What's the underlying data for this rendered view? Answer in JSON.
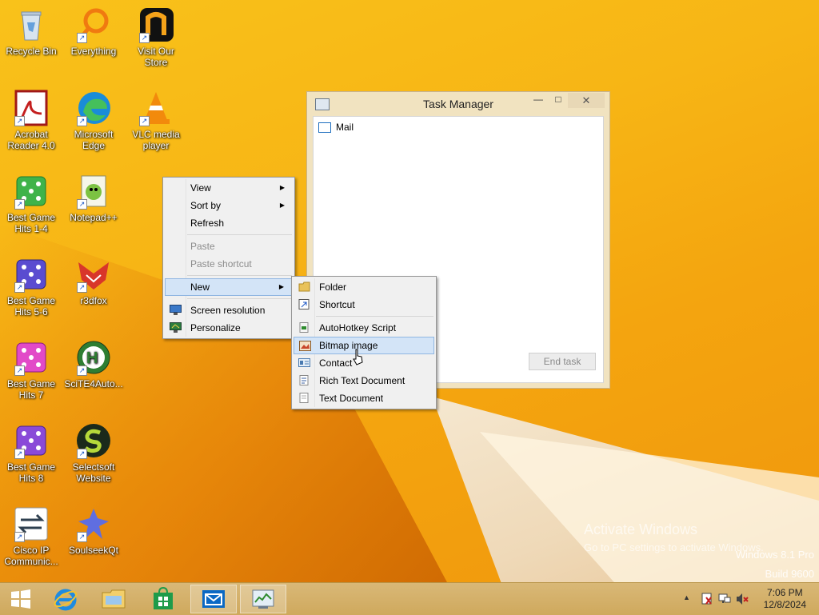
{
  "desktop": {
    "icons": [
      {
        "label": "Recycle Bin",
        "icon": "recycle-bin-icon"
      },
      {
        "label": "Everything",
        "icon": "everything-search-icon"
      },
      {
        "label": "Visit Our Store",
        "icon": "store-icon"
      },
      {
        "label": "Acrobat Reader 4.0",
        "icon": "acrobat-icon"
      },
      {
        "label": "Microsoft Edge",
        "icon": "edge-icon"
      },
      {
        "label": "VLC media player",
        "icon": "vlc-icon"
      },
      {
        "label": "Best Game Hits 1-4",
        "icon": "dice-icon"
      },
      {
        "label": "Notepad++",
        "icon": "notepadpp-icon"
      },
      {
        "label": "Best Game Hits 5-6",
        "icon": "dice-icon"
      },
      {
        "label": "r3dfox",
        "icon": "r3dfox-icon"
      },
      {
        "label": "Best Game Hits 7",
        "icon": "dice-icon"
      },
      {
        "label": "SciTE4Auto...",
        "icon": "scite-icon"
      },
      {
        "label": "Best Game Hits 8",
        "icon": "dice-icon"
      },
      {
        "label": "Selectsoft Website",
        "icon": "selectsoft-icon"
      },
      {
        "label": "Cisco IP Communic...",
        "icon": "cisco-icon"
      },
      {
        "label": "SoulseekQt",
        "icon": "soulseek-icon"
      }
    ]
  },
  "task_manager": {
    "title": "Task Manager",
    "minimize": "—",
    "maximize": "□",
    "close": "✕",
    "tasks": [
      {
        "label": "Mail",
        "icon": "mail-icon"
      }
    ],
    "end_task_label": "End task"
  },
  "context_menu": {
    "items": [
      {
        "label": "View",
        "submenu": true
      },
      {
        "label": "Sort by",
        "submenu": true
      },
      {
        "label": "Refresh"
      },
      {
        "label": "Paste",
        "disabled": true
      },
      {
        "label": "Paste shortcut",
        "disabled": true
      },
      {
        "label": "New",
        "submenu": true,
        "highlighted": true
      },
      {
        "label": "Screen resolution",
        "icon": "monitor-icon"
      },
      {
        "label": "Personalize",
        "icon": "personalize-icon"
      }
    ]
  },
  "new_submenu": {
    "items": [
      {
        "label": "Folder",
        "icon": "folder-icon"
      },
      {
        "label": "Shortcut",
        "icon": "shortcut-icon"
      },
      {
        "label": "AutoHotkey Script",
        "icon": "ahk-file-icon"
      },
      {
        "label": "Bitmap image",
        "icon": "bitmap-icon",
        "highlighted": true
      },
      {
        "label": "Contact",
        "icon": "contact-icon"
      },
      {
        "label": "Rich Text Document",
        "icon": "rtf-icon"
      },
      {
        "label": "Text Document",
        "icon": "text-doc-icon"
      }
    ]
  },
  "watermark": {
    "line1": "Activate Windows",
    "line2": "Go to PC settings to activate Windows.",
    "edition": "Windows 8.1 Pro",
    "build": "Build 9600"
  },
  "taskbar": {
    "items": [
      {
        "name": "start-button",
        "icon": "windows-logo-icon"
      },
      {
        "name": "internet-explorer",
        "icon": "ie-icon"
      },
      {
        "name": "file-explorer",
        "icon": "folder-explorer-icon"
      },
      {
        "name": "store",
        "icon": "store-bag-icon"
      },
      {
        "name": "mail",
        "icon": "mail-icon",
        "active": true
      },
      {
        "name": "task-manager",
        "icon": "task-manager-icon",
        "active": true
      }
    ],
    "tray": {
      "show_hidden": "▲",
      "icons": [
        "action-center-icon",
        "network-icon",
        "volume-muted-icon"
      ]
    },
    "clock": {
      "time": "7:06 PM",
      "date": "12/8/2024"
    }
  }
}
